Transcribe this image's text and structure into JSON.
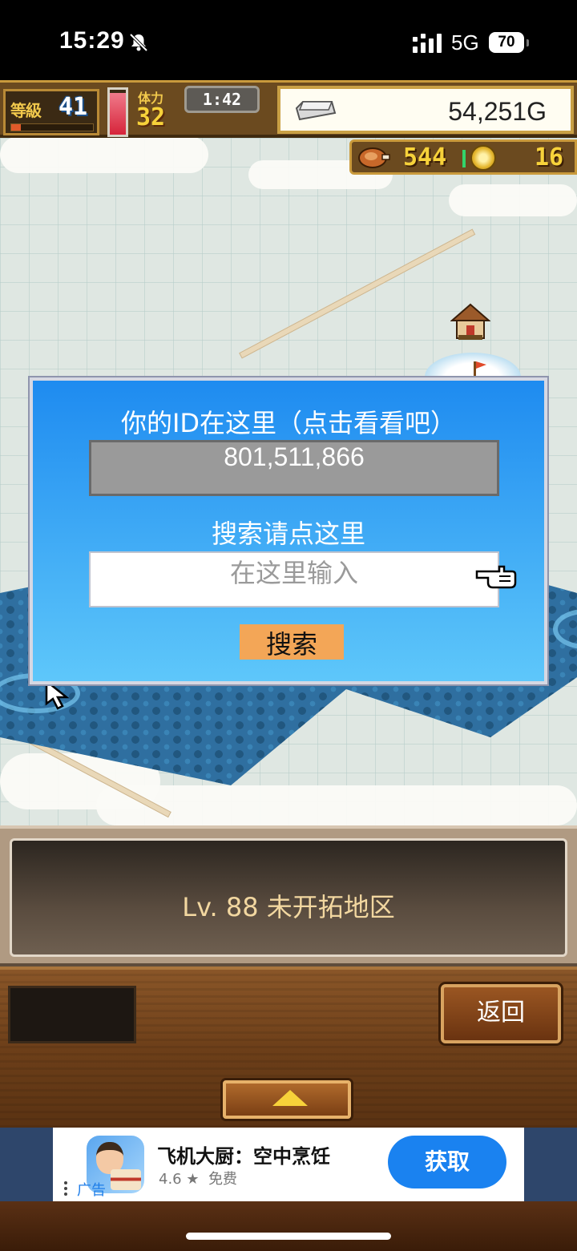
{
  "status_bar": {
    "time": "15:29",
    "network": "5G",
    "battery": "70",
    "icons": [
      "bell-off-icon",
      "signal-icon",
      "battery-icon"
    ]
  },
  "hud": {
    "level_label": "等級",
    "level_value": "41",
    "xp_progress": 0.12,
    "stamina_level": 0.92,
    "hp_label": "体力",
    "hp_value": "32",
    "timer": "1:42",
    "gold": "54,251G",
    "meat": "544",
    "coins": "16",
    "colors": {
      "hud_wood": "#6b4a1f",
      "gold_border": "#c9a045",
      "number_yellow": "#f7d23a"
    }
  },
  "dialog": {
    "title": "你的ID在这里（点击看看吧）",
    "player_id": "801,511,866",
    "search_title": "搜索请点这里",
    "search_placeholder": "在这里输入",
    "search_button": "搜索",
    "colors": {
      "top": "#1e8bf0",
      "bottom": "#5ec7fa",
      "button": "#f3a657"
    }
  },
  "info_panel": {
    "text": "Lv. 88 未开拓地区"
  },
  "controls": {
    "back_button": "返回",
    "expand_icon": "arrow-up-icon"
  },
  "ad": {
    "title": "飞机大厨：空中烹饪",
    "rating": "4.6 ★",
    "price": "免费",
    "label": "广告",
    "get_button": "获取",
    "icon": "app-icon"
  }
}
